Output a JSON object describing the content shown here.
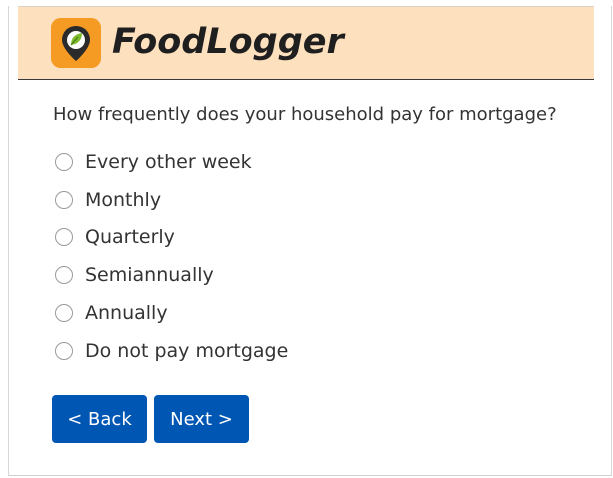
{
  "app": {
    "name": "FoodLogger",
    "logo_icon": "leaf-map-pin-icon",
    "header_color": "#fde0bd",
    "logo_color": "#f59a23"
  },
  "survey": {
    "question": "How frequently does your household pay for mortgage?",
    "options": [
      "Every other week",
      "Monthly",
      "Quarterly",
      "Semiannually",
      "Annually",
      "Do not pay mortgage"
    ],
    "selected": null
  },
  "nav": {
    "back_label": "< Back",
    "next_label": "Next >",
    "button_color": "#0056b3"
  }
}
